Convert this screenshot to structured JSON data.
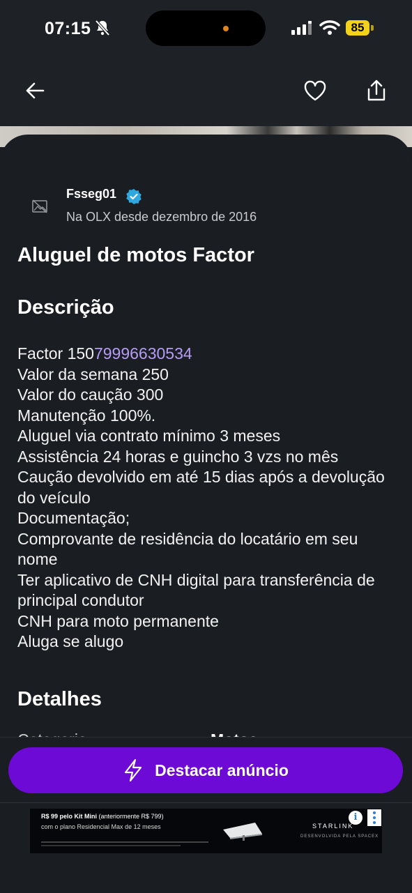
{
  "status_bar": {
    "time": "07:15",
    "battery": "85"
  },
  "seller": {
    "name": "Fsseg01",
    "since": "Na OLX desde dezembro de 2016"
  },
  "listing": {
    "title": "Aluguel de motos Factor",
    "description_heading": "Descrição",
    "description_first_prefix": "Factor 150",
    "description_phone": "79996630534",
    "description_lines": [
      "Valor da semana 250",
      "Valor do caução 300",
      "Manutenção 100%.",
      "Aluguel via contrato mínimo 3 meses",
      "Assistência 24 horas e guincho 3 vzs no mês",
      "Caução devolvido em até 15 dias após a devolução do veículo",
      "Documentação;",
      "Comprovante de residência do locatário em seu nome",
      "Ter aplicativo de CNH digital para transferência de principal condutor",
      "CNH para moto permanente",
      "Aluga se alugo"
    ],
    "details_heading": "Detalhes",
    "details_peek_label": "Categoria",
    "details_peek_value": "Motos"
  },
  "cta": {
    "label": "Destacar anúncio"
  },
  "ad": {
    "headline_bold": "R$ 99 pelo Kit Mini",
    "headline_rest": " (anteriormente R$ 799)",
    "subline": "com o plano Residencial Max de 12 meses",
    "brand": "STARLINK",
    "brand_sub": "DESENVOLVIDA PELA SPACEX"
  },
  "colors": {
    "cta": "#6e0ad6",
    "phone_link": "#b59cf5",
    "verified": "#2fa8e0",
    "background": "#1a1d22"
  }
}
